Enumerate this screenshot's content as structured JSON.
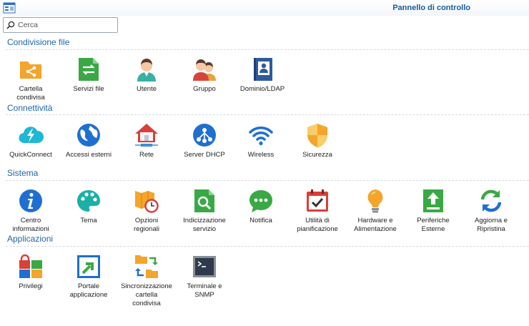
{
  "window": {
    "title": "Pannello di controllo",
    "app_icon": "control-panel-icon"
  },
  "search": {
    "placeholder": "Cerca",
    "value": ""
  },
  "sections": [
    {
      "title": "Condivisione file",
      "items": [
        {
          "label": "Cartella\ncondivisa",
          "icon": "shared-folder-icon"
        },
        {
          "label": "Servizi file",
          "icon": "file-services-icon"
        },
        {
          "label": "Utente",
          "icon": "user-icon"
        },
        {
          "label": "Gruppo",
          "icon": "group-icon"
        },
        {
          "label": "Dominio/LDAP",
          "icon": "domain-ldap-icon"
        }
      ]
    },
    {
      "title": "Connettività",
      "items": [
        {
          "label": "QuickConnect",
          "icon": "quickconnect-icon"
        },
        {
          "label": "Accessi esterni",
          "icon": "globe-icon"
        },
        {
          "label": "Rete",
          "icon": "network-house-icon"
        },
        {
          "label": "Server DHCP",
          "icon": "dhcp-icon"
        },
        {
          "label": "Wireless",
          "icon": "wifi-icon"
        },
        {
          "label": "Sicurezza",
          "icon": "shield-icon"
        }
      ]
    },
    {
      "title": "Sistema",
      "items": [
        {
          "label": "Centro\ninformazioni",
          "icon": "info-icon"
        },
        {
          "label": "Tema",
          "icon": "palette-icon"
        },
        {
          "label": "Opzioni\nregionali",
          "icon": "map-clock-icon"
        },
        {
          "label": "Indicizzazione\nservizio",
          "icon": "indexing-icon"
        },
        {
          "label": "Notifica",
          "icon": "chat-bubble-icon"
        },
        {
          "label": "Utilità di\npianificazione",
          "icon": "calendar-check-icon"
        },
        {
          "label": "Hardware e\nAlimentazione",
          "icon": "lightbulb-icon"
        },
        {
          "label": "Periferiche\nEsterne",
          "icon": "external-devices-icon"
        },
        {
          "label": "Aggiorna e\nRipristina",
          "icon": "refresh-icon"
        }
      ]
    },
    {
      "title": "Applicazioni",
      "items": [
        {
          "label": "Privilegi",
          "icon": "privileges-icon"
        },
        {
          "label": "Portale\napplicazione",
          "icon": "app-portal-icon"
        },
        {
          "label": "Sincronizzazione\ncartella\ncondivisa",
          "icon": "folder-sync-icon"
        },
        {
          "label": "Terminale e\nSNMP",
          "icon": "terminal-icon"
        }
      ]
    }
  ]
}
